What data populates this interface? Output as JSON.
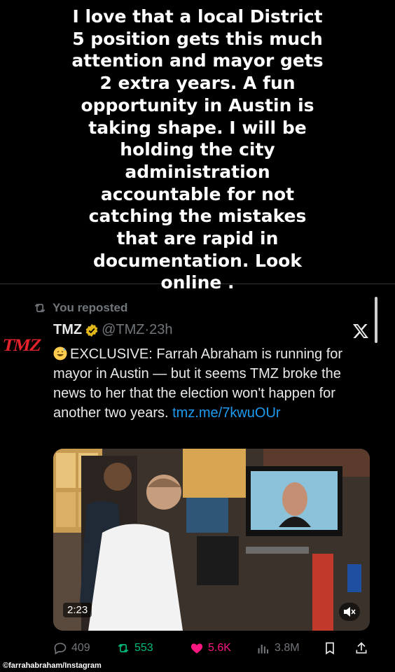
{
  "story_text": "I love that a local District 5 position gets this much attention and mayor gets 2 extra years. A fun opportunity in Austin is taking shape. I will be holding the city administration accountable for not catching the mistakes that are rapid in documentation. Look online .",
  "repost_label": "You reposted",
  "tweet": {
    "avatar_text": "TMZ",
    "name": "TMZ",
    "handle": "@TMZ",
    "separator": "·",
    "time": "23h",
    "text": "EXCLUSIVE: Farrah Abraham is running for mayor in Austin — but it seems TMZ broke the news to her that the election won't happen for another two years. ",
    "link": "tmz.me/7kwuOUr",
    "video_duration": "2:23"
  },
  "actions": {
    "replies": "409",
    "reposts": "553",
    "likes": "5.6K",
    "views": "3.8M"
  },
  "credit": "©farrahabraham/Instagram",
  "colors": {
    "background": "#000000",
    "link": "#1d9bf0",
    "repost_active": "#00ba7c",
    "like_active": "#f91880",
    "muted": "#71767b",
    "brand_tmz": "#e3222b"
  },
  "icons": [
    "repost-icon",
    "verified-badge-icon",
    "x-logo-icon",
    "sweat-smile-emoji-icon",
    "mute-icon",
    "reply-icon",
    "retweet-icon",
    "heart-icon",
    "views-icon",
    "bookmark-icon",
    "share-icon"
  ]
}
